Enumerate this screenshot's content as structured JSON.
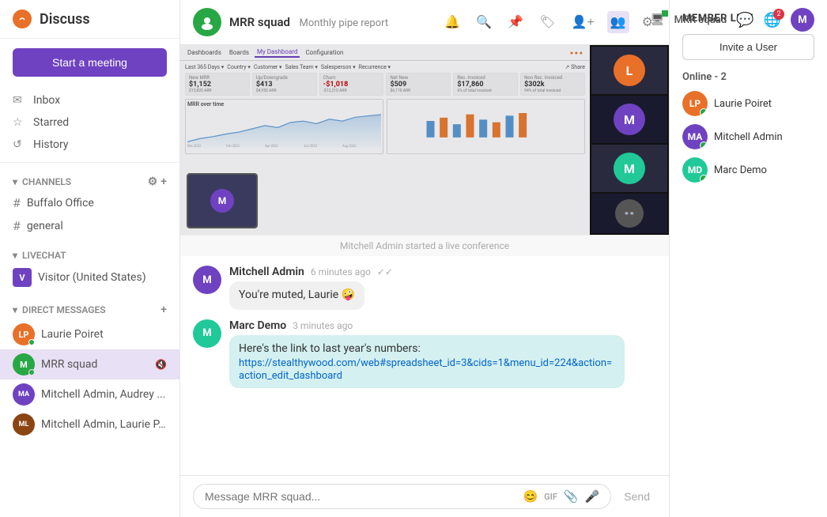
{
  "app": {
    "name": "Discuss",
    "current_channel": "MRR squad",
    "current_channel_sub": "Monthly pipe report"
  },
  "sidebar": {
    "start_meeting": "Start a meeting",
    "nav": [
      {
        "id": "inbox",
        "label": "Inbox",
        "icon": "✉"
      },
      {
        "id": "starred",
        "label": "Starred",
        "icon": "☆"
      },
      {
        "id": "history",
        "label": "History",
        "icon": "↺"
      }
    ],
    "channels_section": "CHANNELS",
    "channels": [
      {
        "id": "buffalo-office",
        "label": "Buffalo Office"
      },
      {
        "id": "general",
        "label": "general"
      }
    ],
    "livechat_section": "LIVECHAT",
    "livechat_items": [
      {
        "id": "visitor-us",
        "label": "Visitor (United States)",
        "initial": "V"
      }
    ],
    "dm_section": "DIRECT MESSAGES",
    "dm_items": [
      {
        "id": "laurie",
        "label": "Laurie Poiret",
        "active": false,
        "online": true
      },
      {
        "id": "mrr-squad",
        "label": "MRR squad",
        "active": true,
        "online": true,
        "muted": true
      },
      {
        "id": "mitchell-audrey",
        "label": "Mitchell Admin, Audrey ...",
        "active": false,
        "online": false
      },
      {
        "id": "mitchell-laurie",
        "label": "Mitchell Admin, Laurie P...",
        "active": false,
        "online": false
      }
    ]
  },
  "chat_header": {
    "name": "MRR squad",
    "subtitle": "Monthly pipe report",
    "icons": [
      "bell",
      "search",
      "pin",
      "tag",
      "add-user",
      "members",
      "settings"
    ]
  },
  "video": {
    "conference_notice": "Mitchell Admin started a live conference",
    "dashboard": {
      "tabs": [
        "Dashboards",
        "Boards",
        "My Dashboard",
        "Configuration"
      ],
      "active_tab": "My Dashboard",
      "top_bar_items": [
        "Dashboards",
        "Boards",
        "My Dashboard",
        "Configuration"
      ],
      "date_filter": "Last 365 Days",
      "country_filter": "Country",
      "customer_filter": "Customer",
      "sales_team_filter": "Sales Team",
      "salesperson_filter": "Salesperson",
      "recurrence_filter": "Recurrence",
      "metrics": [
        {
          "label": "New MRR",
          "value": "$1,152",
          "sub": "$13,820 ARR"
        },
        {
          "label": "Up/Downgrade",
          "value": "$413",
          "sub": "$4,950 ARR"
        },
        {
          "label": "Churn",
          "value": "-$1,018",
          "sub": "-$12,210 ARR"
        },
        {
          "label": "Net New",
          "value": "$509",
          "sub": "$6,110 ARR"
        },
        {
          "label": "Rec. Invoiced",
          "value": "$17,860",
          "sub": "6% of total invoiced"
        },
        {
          "label": "Non Rec.",
          "value": "$302k",
          "sub": "94% of total invoiced"
        }
      ],
      "chart_title": "MRR over time"
    }
  },
  "messages": [
    {
      "id": "msg1",
      "author": "Mitchell Admin",
      "time": "6 minutes ago",
      "text": "You're muted, Laurie 🤪",
      "bubble_type": "light",
      "avatar_color": "av-purple"
    },
    {
      "id": "msg2",
      "author": "Marc Demo",
      "time": "3 minutes ago",
      "text": "Here's the link to last year's numbers:",
      "link": "https://stealthywood.com/web#spreadsheet_id=3&cids=1&menu_id=224&action=action_edit_dashboard",
      "bubble_type": "teal",
      "avatar_color": "av-teal"
    }
  ],
  "input": {
    "placeholder": "Message MRR squad...",
    "send_label": "Send"
  },
  "right_panel": {
    "title": "MEMBER LIST",
    "invite_btn": "Invite a User",
    "online_label": "Online - 2",
    "members": [
      {
        "id": "laurie-poiret",
        "name": "Laurie Poiret",
        "online": true,
        "avatar_color": "av-orange"
      },
      {
        "id": "mitchell-admin",
        "name": "Mitchell Admin",
        "online": true,
        "avatar_color": "av-purple"
      },
      {
        "id": "marc-demo",
        "name": "Marc Demo",
        "online": true,
        "avatar_color": "av-teal"
      }
    ]
  },
  "topbar": {
    "channel_name": "MRR squad",
    "notification_count": "2"
  }
}
